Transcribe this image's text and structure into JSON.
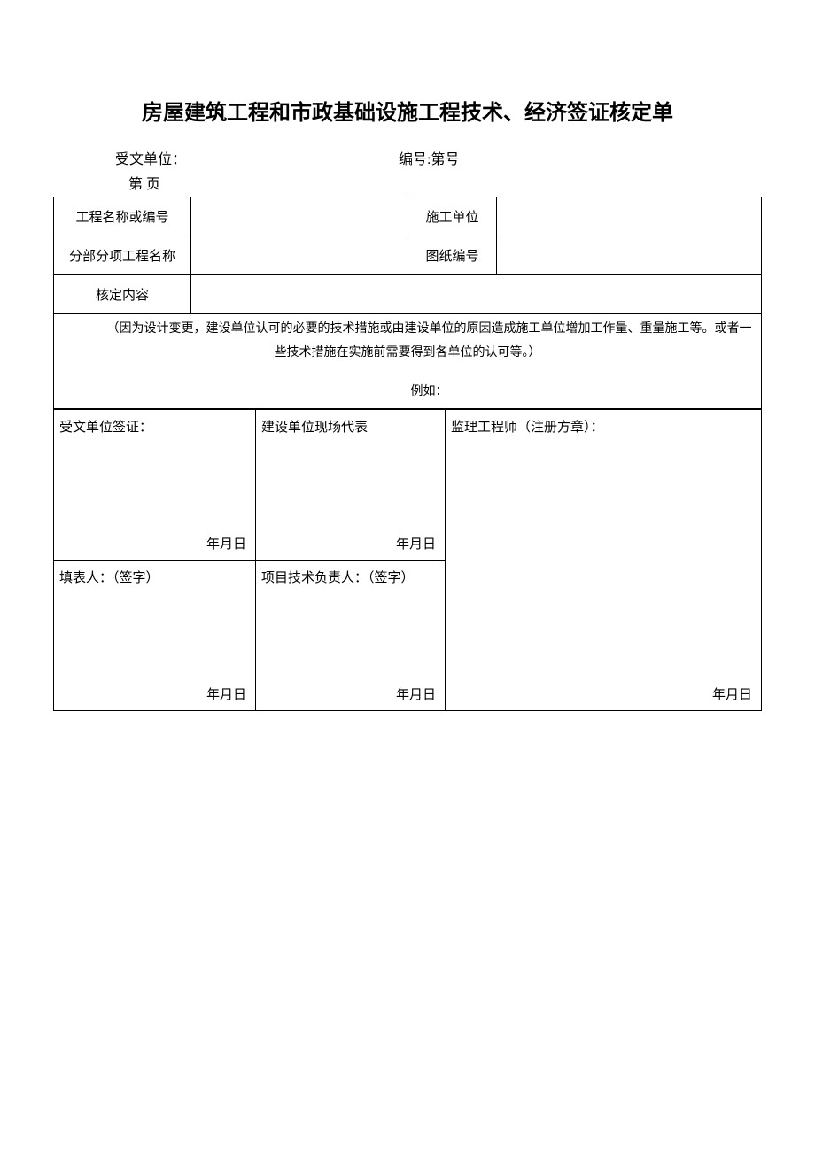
{
  "title": "房屋建筑工程和市政基础设施工程技术、经济签证核定单",
  "meta": {
    "recipient_label": "受文单位：",
    "serial_label": "编号:第号",
    "page_label": "第 页"
  },
  "header_rows": {
    "r1c1": "工程名称或编号",
    "r1c3": "施工单位",
    "r2c1": "分部分项工程名称",
    "r2c3": "图纸编号",
    "r3c1": "核定内容"
  },
  "body": {
    "paragraph": "（因为设计变更，建设单位认可的必要的技术措施或由建设单位的原因造成施工单位增加工作量、重量施工等。或者一些技术措施在实施前需要得到各单位的认可等。）",
    "example": "例如："
  },
  "signatures": {
    "r1c1": "受文单位签证：",
    "r1c2": "建设单位现场代表",
    "r1c3": "监理工程师（注册方章）：",
    "r2c1": "填表人：（签字）",
    "r2c2": "项目技术负责人：（签字）",
    "date": "年月日"
  }
}
